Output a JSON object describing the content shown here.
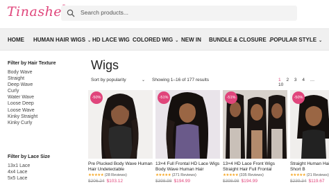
{
  "brand": {
    "logo": "Tinashe",
    "reg": "®"
  },
  "search": {
    "placeholder": "Search products..."
  },
  "nav": [
    {
      "label": "HOME",
      "chevron": ""
    },
    {
      "label": "HUMAN HAIR WIGS",
      "chevron": "⌄"
    },
    {
      "label": "HD LACE WIG",
      "chevron": ""
    },
    {
      "label": "COLORED WIG",
      "chevron": "⌄"
    },
    {
      "label": "NEW IN",
      "chevron": ""
    },
    {
      "label": "BUNDLE & CLOSURE",
      "chevron": "⌄"
    },
    {
      "label": "POPULAR STYLE",
      "chevron": "⌄"
    }
  ],
  "sidebar": {
    "texture_title": "Filter by Hair Texture",
    "textures": [
      "Body Wave",
      "Straight",
      "Deep Wave",
      "Curly",
      "Water Wave",
      "Loose Deep",
      "Loose Wave",
      "Kinky Straight",
      "Kinky Curly"
    ],
    "lace_title": "Filter by Lace Size",
    "lace_sizes": [
      "13x1 Lace",
      "4x4 Lace",
      "5x5 Lace"
    ]
  },
  "page": {
    "title": "Wigs",
    "sort_label": "Sort by popularity",
    "showing": "Showing 1–16 of 177 results",
    "pages": [
      "1",
      "2",
      "3",
      "4",
      "…",
      "10"
    ],
    "active_page": "1"
  },
  "products": [
    {
      "badge": "-50%",
      "title": "Pre Plucked Body Wave Human Hair Undetectable",
      "stars": "★★★★★",
      "reviews": "(28 Reviews)",
      "old_price": "$206.24",
      "new_price": "$103.12"
    },
    {
      "badge": "-51%",
      "title": "13×4 Full Frontal HD Lace Wigs Body Wave Human Hair",
      "stars": "★★★★★",
      "reviews": "(271 Reviews)",
      "old_price": "$398.98",
      "new_price": "$194.99"
    },
    {
      "badge": "-51%",
      "title": "13×4 HD Lace Front Wigs Straight Hair Full Frontal",
      "stars": "★★★★★",
      "reviews": "(335 Reviews)",
      "old_price": "$398.98",
      "new_price": "$194.99"
    },
    {
      "badge": "-50%",
      "title": "Straight Human Hair Lace Front Short B",
      "stars": "★★★★★",
      "reviews": "(21 Reviews)",
      "old_price": "$239.34",
      "new_price": "$119.67"
    }
  ],
  "colors": {
    "accent": "#e0457b",
    "star": "#f5a623",
    "nav_bg": "#f0f0f0"
  }
}
